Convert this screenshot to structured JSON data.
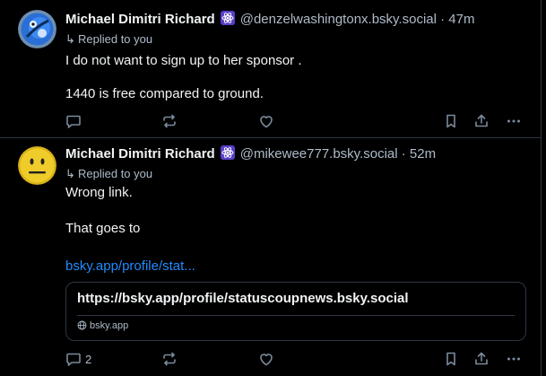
{
  "posts": [
    {
      "display_name": "Michael Dimitri Richard",
      "badge_icon": "atom-icon",
      "handle": "@denzelwashingtonx.bsky.social",
      "separator": "·",
      "time": "47m",
      "replied_to": "Replied to you",
      "lines": [
        "I do not want to sign up to her sponsor .",
        "1440 is free compared to ground."
      ],
      "actions": {
        "reply_count": "",
        "repost_count": "",
        "like_count": ""
      }
    },
    {
      "display_name": "Michael Dimitri Richard",
      "badge_icon": "atom-icon",
      "handle": "@mikewee777.bsky.social",
      "separator": "·",
      "time": "52m",
      "replied_to": "Replied to you",
      "lines": [
        "Wrong link.",
        "That goes to"
      ],
      "link_text": "bsky.app/profile/stat...",
      "embed": {
        "url": "https://bsky.app/profile/statuscoupnews.bsky.social",
        "domain": "bsky.app"
      },
      "actions": {
        "reply_count": "2",
        "repost_count": "",
        "like_count": ""
      }
    }
  ],
  "colors": {
    "background": "#000000",
    "link": "#208bfe",
    "muted": "#aebbc9",
    "badge": "#5b3ec7"
  }
}
